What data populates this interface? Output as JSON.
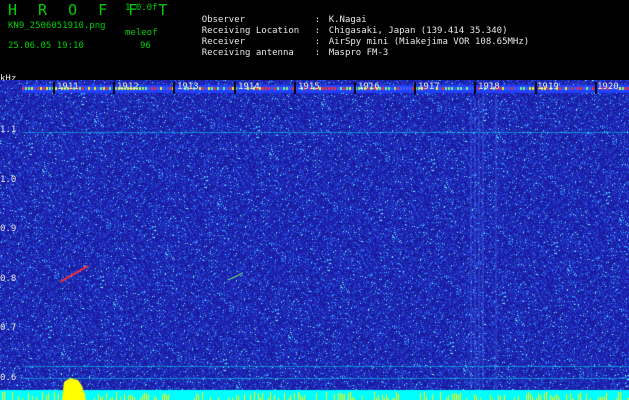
{
  "header": {
    "app_title": "H R O F F T",
    "version": "1.0.0f",
    "filename": "KN9_2506051910.png",
    "datetime": "25.06.05 19:10",
    "mode_label": "meleof",
    "mode_value": "96",
    "fields": [
      {
        "key": "Observer",
        "value": "K.Nagai"
      },
      {
        "key": "Receiving Location",
        "value": "Chigasaki, Japan (139.414 35.340)"
      },
      {
        "key": "Receiver",
        "value": "AirSpy mini (Miakejima VOR 108.65MHz)"
      },
      {
        "key": "Receiving antenna",
        "value": "Maspro FM-3"
      }
    ]
  },
  "spectrogram": {
    "y_unit": "kHz",
    "y_ticks": [
      "1.1",
      "1.0",
      "0.9",
      "0.8",
      "0.7",
      "0.6"
    ],
    "x_ticks": [
      "1911",
      "1912",
      "1913",
      "1914",
      "1915",
      "1916",
      "1917",
      "1918",
      "1919",
      "1920"
    ],
    "colors": {
      "background": "#1a1aa0",
      "noise_light": "#3a6cff",
      "cyan": "#00ffff",
      "yellow": "#ffff00",
      "red": "#ff3030"
    }
  }
}
